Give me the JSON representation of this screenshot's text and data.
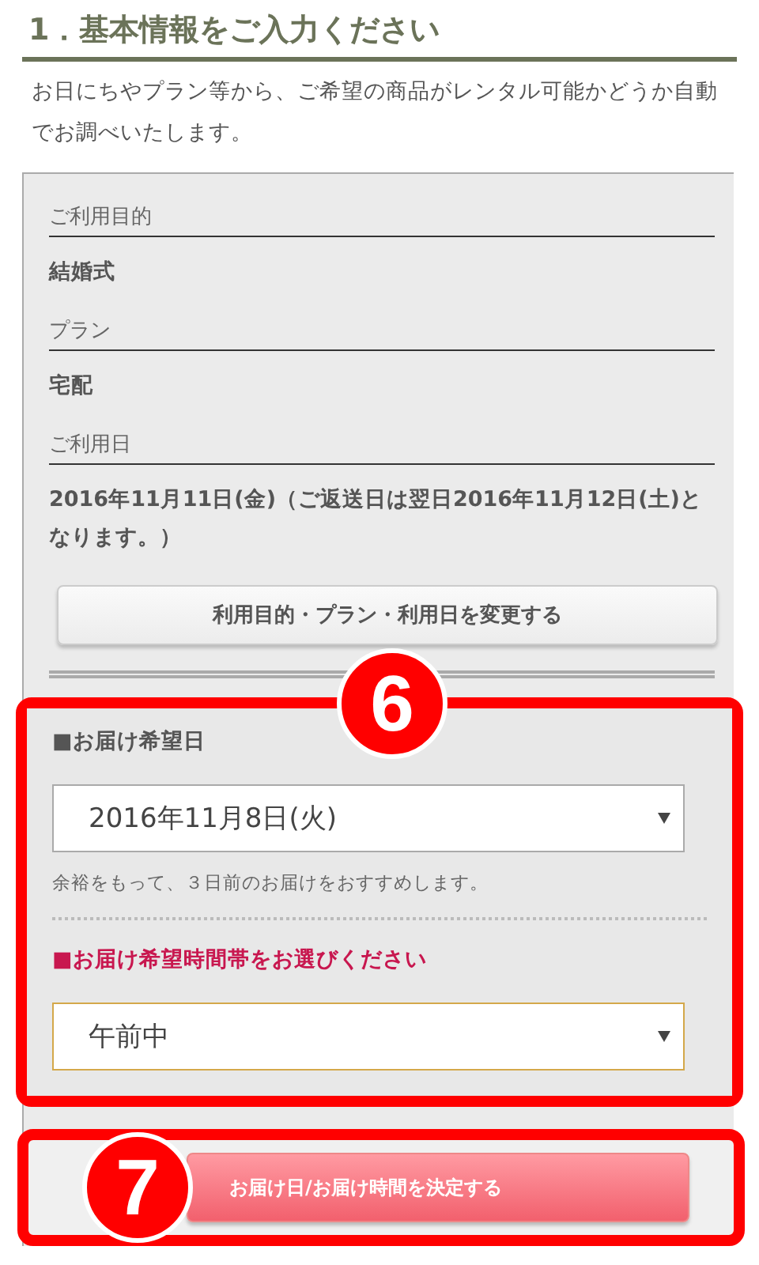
{
  "heading": "1．基本情報をご入力ください",
  "intro": "お日にちやプラン等から、ご希望の商品がレンタル可能かどうか自動でお調べいたします。",
  "summary": {
    "fields": [
      {
        "label": "ご利用目的",
        "value": "結婚式"
      },
      {
        "label": "プラン",
        "value": "宅配"
      },
      {
        "label": "ご利用日",
        "value": "2016年11月11日(金)（ご返送日は翌日2016年11月12日(土)となります。）"
      }
    ],
    "change_button": "利用目的・プラン・利用日を変更する"
  },
  "delivery": {
    "marker": "6",
    "date": {
      "label": "■お届け希望日",
      "emphasized": false,
      "value": "2016年11月8日(火)",
      "focused": false,
      "hint": "余裕をもって、３日前のお届けをおすすめします。"
    },
    "time": {
      "label": "■お届け希望時間帯をお選びください",
      "emphasized": true,
      "value": "午前中",
      "focused": true
    }
  },
  "submit": {
    "marker": "7",
    "label": "お届け日/お届け時間を決定する"
  }
}
